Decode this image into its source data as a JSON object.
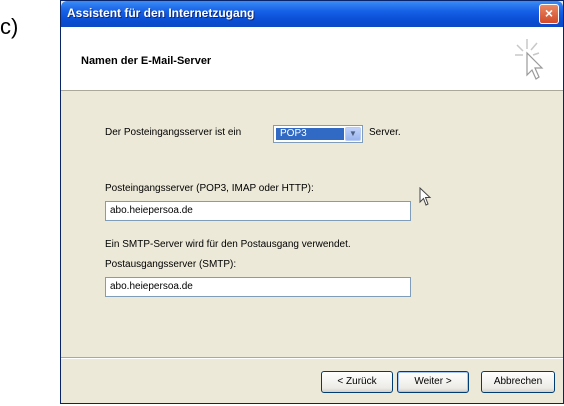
{
  "figure_label": "c)",
  "window": {
    "title": "Assistent für den Internetzugang",
    "close_glyph": "×"
  },
  "header": {
    "title": "Namen der E-Mail-Server",
    "icon": "wizard-star-cursor-icon"
  },
  "incoming_type": {
    "prefix": "Der Posteingangsserver ist ein",
    "selected": "POP3",
    "suffix": "Server."
  },
  "incoming": {
    "label": "Posteingangsserver (POP3, IMAP oder HTTP):",
    "value": "abo.heiepersoa.de"
  },
  "smtp_info": "Ein SMTP-Server wird für den Postausgang verwendet.",
  "outgoing": {
    "label": "Postausgangsserver (SMTP):",
    "value": "abo.heiepersoa.de"
  },
  "buttons": {
    "back": "< Zurück",
    "next": "Weiter >",
    "cancel": "Abbrechen"
  },
  "colors": {
    "titlebar": "#0a4fd6",
    "dialog_bg": "#ece9d8",
    "selection": "#316ac5"
  }
}
